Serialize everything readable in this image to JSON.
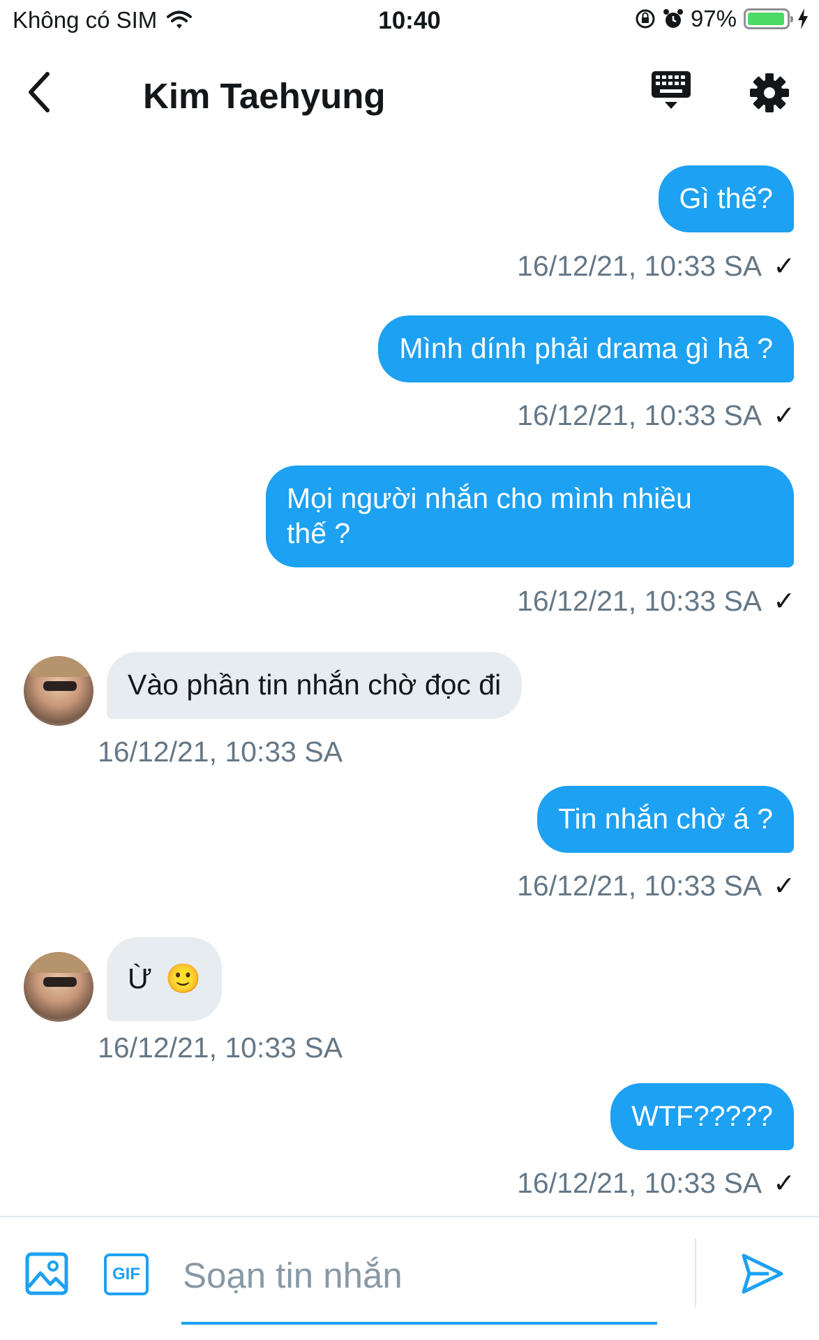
{
  "status_bar": {
    "carrier": "Không có SIM",
    "time": "10:40",
    "battery_percent": "97%",
    "battery_level": 0.97
  },
  "header": {
    "title": "Kim Taehyung",
    "back_icon": "chevron-left-icon",
    "keyboard_icon": "keyboard-icon",
    "settings_icon": "gear-icon"
  },
  "messages": [
    {
      "direction": "out",
      "text": "Gì thế?",
      "timestamp": "16/12/21, 10:33 SA",
      "status": "✓"
    },
    {
      "direction": "out",
      "text": "Mình dính phải drama gì hả ?",
      "timestamp": "16/12/21, 10:33 SA",
      "status": "✓"
    },
    {
      "direction": "out",
      "text_line1": "Mọi người nhắn cho mình nhiều",
      "text_line2": "thế ?",
      "timestamp": "16/12/21, 10:33 SA",
      "status": "✓"
    },
    {
      "direction": "in",
      "text": "Vào phần tin nhắn chờ đọc đi",
      "timestamp": "16/12/21, 10:33 SA"
    },
    {
      "direction": "out",
      "text": "Tin nhắn chờ á ?",
      "timestamp": "16/12/21, 10:33 SA",
      "status": "✓"
    },
    {
      "direction": "in",
      "text": "Ừ",
      "emoji": "🙂",
      "timestamp": "16/12/21, 10:33 SA"
    },
    {
      "direction": "out",
      "text": "WTF?????",
      "timestamp": "16/12/21, 10:33 SA",
      "status": "✓"
    }
  ],
  "composer": {
    "placeholder": "Soạn tin nhắn",
    "gif_label": "GIF",
    "image_icon": "image-icon",
    "send_icon": "send-icon"
  },
  "colors": {
    "accent": "#1da1f2",
    "incoming_bubble": "#e6ecf0",
    "timestamp": "#657786"
  }
}
